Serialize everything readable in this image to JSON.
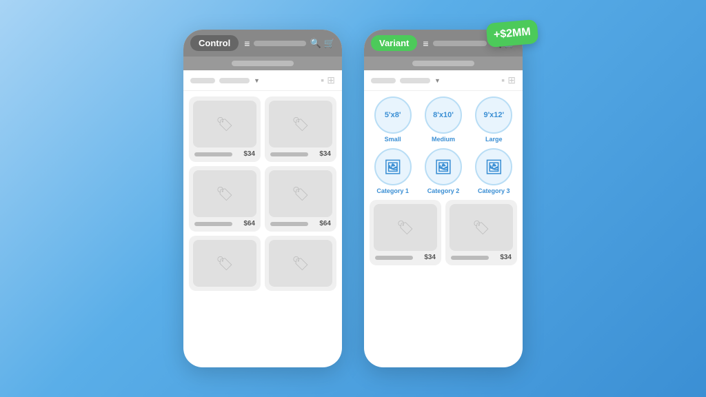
{
  "control": {
    "label": "Control",
    "header_bar_placeholder": "",
    "subheader_bar": "",
    "filter_label": "",
    "products": [
      {
        "price": "$34"
      },
      {
        "price": "$34"
      },
      {
        "price": "$64"
      },
      {
        "price": "$64"
      },
      {
        "price": ""
      },
      {
        "price": ""
      }
    ]
  },
  "variant": {
    "label": "Variant",
    "badge": "+$2MM",
    "sizes": [
      {
        "label": "5'x8'",
        "sublabel": "Small"
      },
      {
        "label": "8'x10'",
        "sublabel": "Medium"
      },
      {
        "label": "9'x12'",
        "sublabel": "Large"
      }
    ],
    "categories": [
      {
        "label": "Category 1"
      },
      {
        "label": "Category 2"
      },
      {
        "label": "Category 3"
      }
    ],
    "products": [
      {
        "price": "$34"
      },
      {
        "price": "$34"
      }
    ]
  },
  "icons": {
    "menu": "≡",
    "search": "🔍",
    "cart": "🛒",
    "tag": "🏷",
    "image": "🖼",
    "grid_single": "▪",
    "grid_four": "⊞"
  }
}
